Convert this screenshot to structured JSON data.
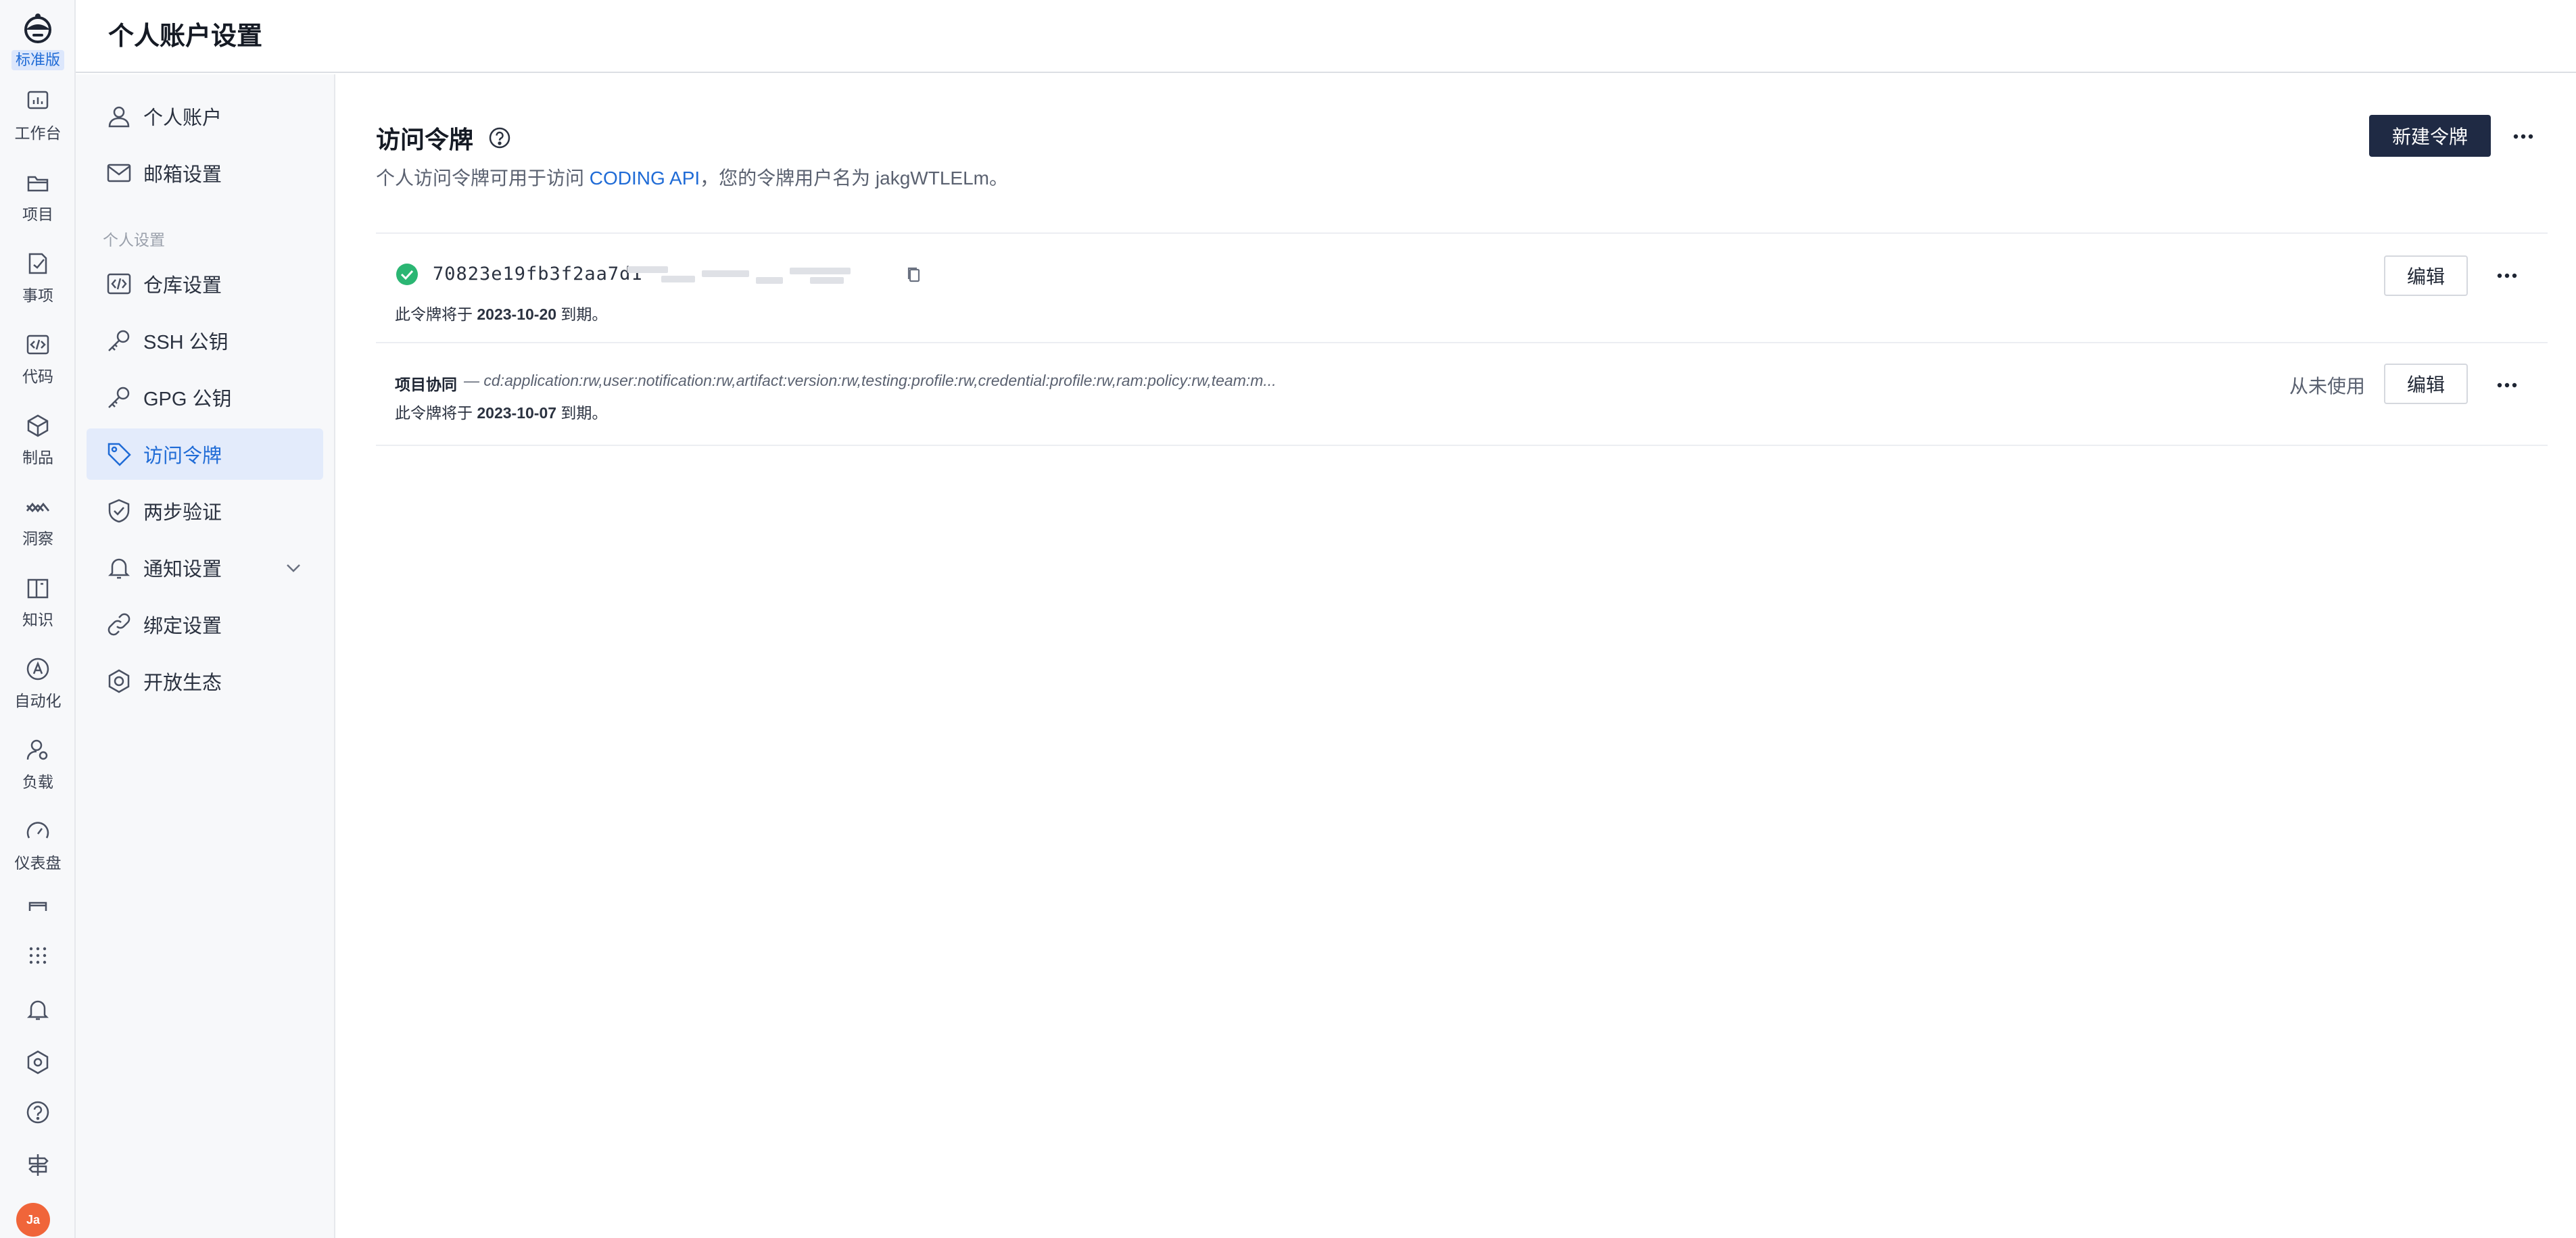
{
  "rail": {
    "edition": "标准版",
    "items": [
      {
        "label": "工作台",
        "icon": "dashboard-icon"
      },
      {
        "label": "项目",
        "icon": "folder-icon"
      },
      {
        "label": "事项",
        "icon": "issue-icon"
      },
      {
        "label": "代码",
        "icon": "code-icon"
      },
      {
        "label": "制品",
        "icon": "package-icon"
      },
      {
        "label": "洞察",
        "icon": "insight-icon"
      },
      {
        "label": "知识",
        "icon": "book-icon"
      },
      {
        "label": "自动化",
        "icon": "automation-icon"
      },
      {
        "label": "负载",
        "icon": "workload-icon"
      },
      {
        "label": "仪表盘",
        "icon": "gauge-icon"
      }
    ],
    "avatar": "Ja"
  },
  "header": {
    "title": "个人账户设置"
  },
  "sidebar": {
    "items": [
      {
        "label": "个人账户"
      },
      {
        "label": "邮箱设置"
      },
      {
        "label": "仓库设置"
      },
      {
        "label": "SSH 公钥"
      },
      {
        "label": "GPG 公钥"
      },
      {
        "label": "访问令牌"
      },
      {
        "label": "两步验证"
      },
      {
        "label": "通知设置"
      },
      {
        "label": "绑定设置"
      },
      {
        "label": "开放生态"
      }
    ],
    "group_label": "个人设置",
    "active": "访问令牌"
  },
  "main": {
    "title": "访问令牌",
    "desc_prefix": "个人访问令牌可用于访问 ",
    "desc_link": "CODING API",
    "desc_suffix": "，您的令牌用户名为 jakgWTLELm。",
    "new_button": "新建令牌",
    "tokens": [
      {
        "code": "70823e19fb3f2aa7d1",
        "expiry_prefix": "此令牌将于 ",
        "expiry_date": "2023-10-20",
        "expiry_suffix": " 到期。",
        "edit": "编辑"
      },
      {
        "name": "项目协同",
        "scopes": "— cd:application:rw,user:notification:rw,artifact:version:rw,testing:profile:rw,credential:profile:rw,ram:policy:rw,team:m...",
        "usage": "从未使用",
        "expiry_prefix": "此令牌将于 ",
        "expiry_date": "2023-10-07",
        "expiry_suffix": " 到期。",
        "edit": "编辑"
      }
    ]
  },
  "colors": {
    "accent": "#1f6bd6",
    "primary_button": "#1f2a44",
    "success": "#2bb673"
  }
}
